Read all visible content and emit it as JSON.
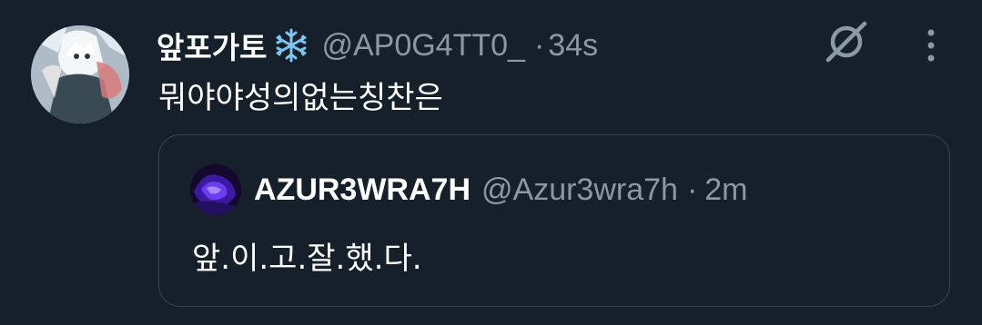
{
  "tweet": {
    "display_name": "앞포가토",
    "name_emoji": "snowflake-icon",
    "handle": "@AP0G4TT0_",
    "separator": "·",
    "time": "34s",
    "text": "뭐야야성의없는칭찬은"
  },
  "actions": {
    "grok_icon": "grok-icon",
    "more_icon": "more-icon"
  },
  "quote": {
    "display_name": "AZUR3WRA7H",
    "handle": "@Azur3wra7h",
    "separator": "·",
    "time": "2m",
    "text": "앞.이.고.잘.했.다."
  },
  "colors": {
    "background": "#15202b",
    "primary_text": "#e7e9ea",
    "secondary_text": "#8b98a5",
    "border": "#38444d"
  }
}
